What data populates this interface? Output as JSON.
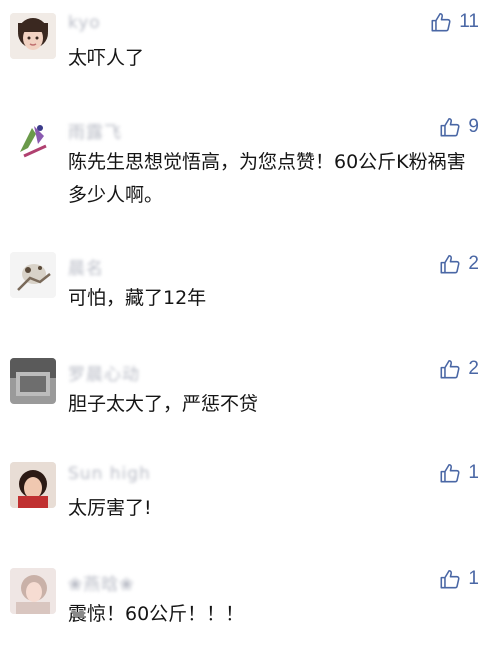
{
  "accent_color": "#4a67a5",
  "comments": [
    {
      "name": "kyo",
      "text": "太吓人了",
      "likes": "11",
      "avatar_icon": "user-avatar-photo",
      "like_icon": "thumbs-up-icon"
    },
    {
      "name": "雨露飞",
      "text": "陈先生思想觉悟高，为您点赞！60公斤K粉祸害多少人啊。",
      "likes": "9",
      "avatar_icon": "user-avatar-drawing",
      "like_icon": "thumbs-up-icon"
    },
    {
      "name": "晨名",
      "text": "可怕，藏了12年",
      "likes": "2",
      "avatar_icon": "user-avatar-photo",
      "like_icon": "thumbs-up-icon"
    },
    {
      "name": "罗晨心动",
      "text": "胆子太大了，严惩不贷",
      "likes": "2",
      "avatar_icon": "user-avatar-photo",
      "like_icon": "thumbs-up-icon"
    },
    {
      "name": "Sun high",
      "text": "太厉害了!",
      "likes": "1",
      "avatar_icon": "user-avatar-photo",
      "like_icon": "thumbs-up-icon"
    },
    {
      "name": "❀燕晗❀",
      "text": "震惊！60公斤！！！",
      "likes": "1",
      "avatar_icon": "user-avatar-photo",
      "like_icon": "thumbs-up-icon"
    }
  ]
}
